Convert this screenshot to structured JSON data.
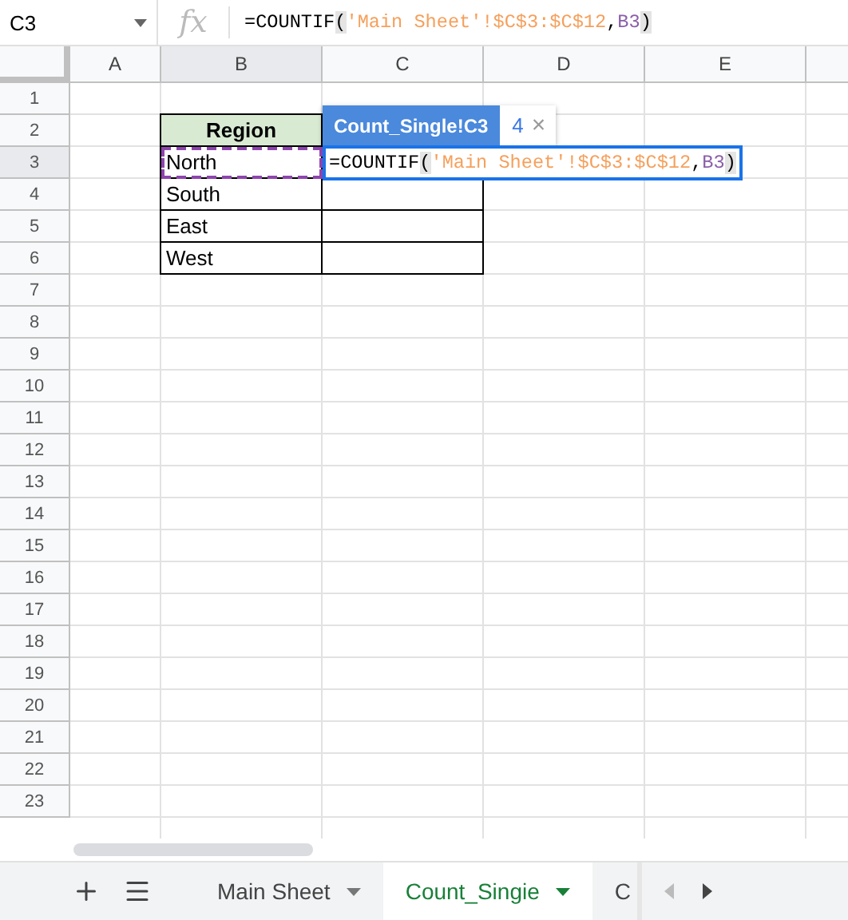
{
  "name_box": "C3",
  "fx_label": "fx",
  "formula_bar": [
    {
      "text": "=COUNTIF",
      "kind": "plain"
    },
    {
      "text": "(",
      "kind": "paren"
    },
    {
      "text": "'Main Sheet'!$C$3:$C$12",
      "kind": "range"
    },
    {
      "text": ",",
      "kind": "plain"
    },
    {
      "text": "B3",
      "kind": "ref"
    },
    {
      "text": ")",
      "kind": "paren"
    }
  ],
  "columns": [
    {
      "label": "A",
      "selected": false
    },
    {
      "label": "B",
      "selected": true
    },
    {
      "label": "C",
      "selected": false
    },
    {
      "label": "D",
      "selected": false
    },
    {
      "label": "E",
      "selected": false
    }
  ],
  "rows": [
    {
      "label": "1",
      "selected": false
    },
    {
      "label": "2",
      "selected": false
    },
    {
      "label": "3",
      "selected": true
    },
    {
      "label": "4",
      "selected": false
    },
    {
      "label": "5",
      "selected": false
    },
    {
      "label": "6",
      "selected": false
    },
    {
      "label": "7",
      "selected": false
    },
    {
      "label": "8",
      "selected": false
    },
    {
      "label": "9",
      "selected": false
    },
    {
      "label": "10",
      "selected": false
    },
    {
      "label": "11",
      "selected": false
    },
    {
      "label": "12",
      "selected": false
    },
    {
      "label": "13",
      "selected": false
    },
    {
      "label": "14",
      "selected": false
    },
    {
      "label": "15",
      "selected": false
    },
    {
      "label": "16",
      "selected": false
    },
    {
      "label": "17",
      "selected": false
    },
    {
      "label": "18",
      "selected": false
    },
    {
      "label": "19",
      "selected": false
    },
    {
      "label": "20",
      "selected": false
    },
    {
      "label": "21",
      "selected": false
    },
    {
      "label": "22",
      "selected": false
    },
    {
      "label": "23",
      "selected": false
    }
  ],
  "table": {
    "header": "Region",
    "values": [
      "North",
      "South",
      "East",
      "West"
    ]
  },
  "tooltip": {
    "reference": "Count_Single!C3",
    "result": "4",
    "close": "×"
  },
  "cell_editor": [
    {
      "text": "=COUNTIF",
      "kind": "plain"
    },
    {
      "text": "(",
      "kind": "paren"
    },
    {
      "text": "'Main Sheet'!$C$3:$C$12",
      "kind": "range"
    },
    {
      "text": ",",
      "kind": "plain"
    },
    {
      "text": "B3",
      "kind": "ref"
    },
    {
      "text": ")",
      "kind": "paren"
    }
  ],
  "sheet_tabs": [
    {
      "label": "Main Sheet",
      "selected": false
    },
    {
      "label": "Count_Singie",
      "selected": true
    },
    {
      "label": "C",
      "selected": false
    }
  ]
}
